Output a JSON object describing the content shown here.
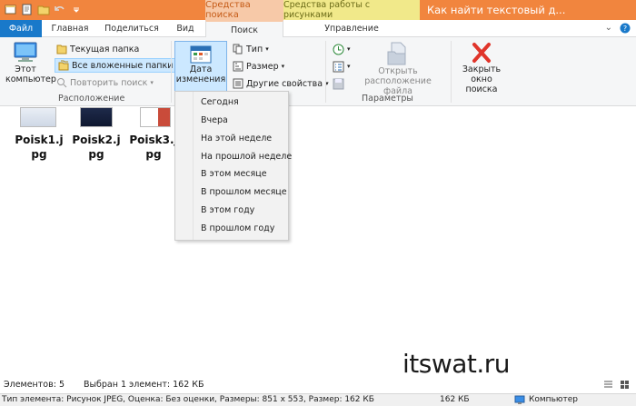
{
  "titlebar": {
    "context_search": "Средства поиска",
    "context_pictures": "Средства работы с рисунками",
    "window_title": "Как найти текстовый д..."
  },
  "tabs": {
    "file": "Файл",
    "home": "Главная",
    "share": "Поделиться",
    "view": "Вид",
    "search": "Поиск",
    "manage": "Управление"
  },
  "ribbon": {
    "this_pc": "Этот компьютер",
    "current_folder": "Текущая папка",
    "all_subfolders": "Все вложенные папки",
    "repeat_search": "Повторить поиск",
    "location_label": "Расположение",
    "date_modified": "Дата изменения",
    "type": "Тип",
    "size": "Размер",
    "other_props": "Другие свойства",
    "open_location": "Открыть расположение файла",
    "parameters_label": "Параметры",
    "close_search": "Закрыть окно поиска"
  },
  "files": [
    {
      "name_line1": "Poisk1.j",
      "name_line2": "pg"
    },
    {
      "name_line1": "Poisk2.j",
      "name_line2": "pg"
    },
    {
      "name_line1": "Poisk3.j",
      "name_line2": "pg"
    }
  ],
  "date_menu": [
    "Сегодня",
    "Вчера",
    "На этой неделе",
    "На прошлой неделе",
    "В этом месяце",
    "В прошлом месяце",
    "В этом году",
    "В прошлом году"
  ],
  "status": {
    "items": "Элементов: 5",
    "selected": "Выбран 1 элемент: 162 КБ"
  },
  "details": {
    "info": "Тип элемента: Рисунок JPEG, Оценка: Без оценки, Размеры: 851 x 553, Размер: 162 КБ",
    "size": "162 КБ",
    "location": "Компьютер"
  },
  "watermark": "itswat.ru",
  "colors": {
    "titlebar": "#f1853e",
    "file_tab": "#1979ca",
    "selection": "#cce8ff"
  }
}
